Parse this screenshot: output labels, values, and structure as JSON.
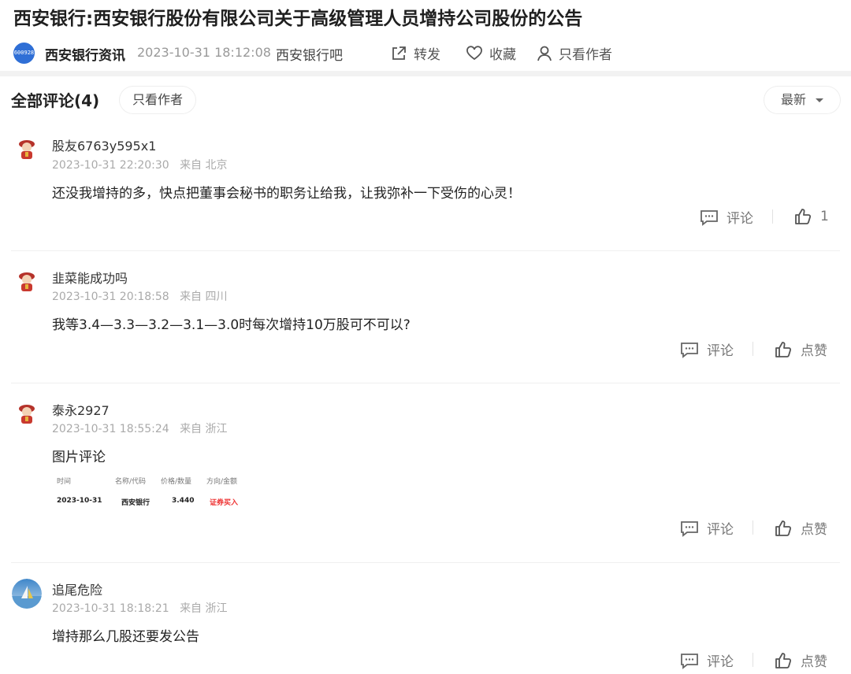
{
  "post": {
    "title": "西安银行:西安银行股份有限公司关于高级管理人员增持公司股份的公告",
    "logo_text": "600928",
    "source": "西安银行资讯",
    "time": "2023-10-31 18:12:08",
    "bar": "西安银行吧",
    "actions": {
      "share": "转发",
      "favorite": "收藏",
      "author_only": "只看作者"
    }
  },
  "comments_header": {
    "title": "全部评论(4)",
    "author_only": "只看作者",
    "sort": "最新"
  },
  "comments": [
    {
      "user": "股友6763y595x1",
      "time": "2023-10-31 22:20:30",
      "location": "来自 北京",
      "text": "还没我增持的多，快点把董事会秘书的职务让给我，让我弥补一下受伤的心灵！",
      "reply": "评论",
      "like": "1"
    },
    {
      "user": "韭菜能成功吗",
      "time": "2023-10-31 20:18:58",
      "location": "来自 四川",
      "text": "我等3.4—3.3—3.2—3.1—3.0时每次增持10万股可不可以?",
      "reply": "评论",
      "like": "点赞"
    },
    {
      "user": "泰永2927",
      "time": "2023-10-31 18:55:24",
      "location": "来自 浙江",
      "text": "图片评论",
      "reply": "评论",
      "like": "点赞",
      "trade": {
        "headers": [
          "时间",
          "名称/代码",
          "价格/数量",
          "方向/金额"
        ],
        "values": [
          "2023-10-31",
          "西安银行",
          "3.440",
          "证券买入"
        ]
      }
    },
    {
      "user": "追尾危险",
      "time": "2023-10-31 18:18:21",
      "location": "来自 浙江",
      "text": "增持那么几股还要发公告",
      "reply": "评论",
      "like": "点赞"
    }
  ],
  "colors": {
    "accent": "#2f6fd6",
    "trade_buy": "#e33333"
  }
}
